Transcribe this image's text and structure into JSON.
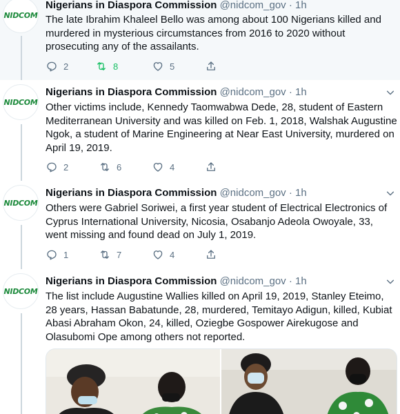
{
  "colors": {
    "text": "#0f1419",
    "secondary": "#5b7083",
    "retweet_active": "#17bf63",
    "highlight_bg": "#f5f8fa",
    "logo_green": "#1d8a3c"
  },
  "avatar_text": "NIDCOM",
  "tweets": [
    {
      "name": "Nigerians in Diaspora Commission",
      "handle": "@nidcom_gov",
      "dot": "·",
      "time": "1h",
      "text": "The late Ibrahim Khaleel Bello was among about 100 Nigerians  killed and murdered in mysterious circumstances from 2016 to 2020 without prosecuting any of the assailants.",
      "replies": "2",
      "retweets": "8",
      "likes": "5"
    },
    {
      "name": "Nigerians in Diaspora Commission",
      "handle": "@nidcom_gov",
      "dot": "·",
      "time": "1h",
      "text": "Other victims include, Kennedy Taomwabwa Dede, 28, student of Eastern Mediterranean University and was killed on Feb. 1, 2018, Walshak Augustine Ngok, a student of Marine Engineering at Near East  University, murdered on April 19, 2019.",
      "replies": "2",
      "retweets": "6",
      "likes": "4"
    },
    {
      "name": "Nigerians in Diaspora Commission",
      "handle": "@nidcom_gov",
      "dot": "·",
      "time": "1h",
      "text": "Others were Gabriel Soriwei, a first year student of Electrical Electronics of Cyprus International University,  Nicosia, Osabanjo Adeola Owoyale, 33, went missing and found dead on July 1, 2019.",
      "replies": "1",
      "retweets": "7",
      "likes": "4"
    },
    {
      "name": "Nigerians in Diaspora Commission",
      "handle": "@nidcom_gov",
      "dot": "·",
      "time": "1h",
      "text": "The list include Augustine Wallies killed on April 19, 2019, Stanley Eteimo, 28 years, Hassan Babatunde, 28, murdered, Temitayo Adigun, killed, Kubiat Abasi Abraham Okon, 24, killed, Oziegbe Gospower Airekugose and Olasubomi Ope among others not reported."
    }
  ]
}
